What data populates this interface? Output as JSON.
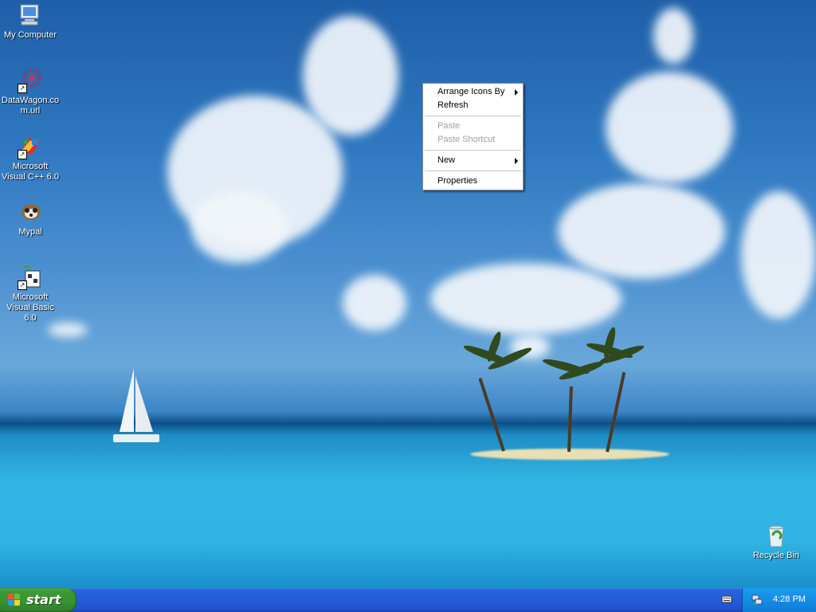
{
  "desktop": {
    "icons": [
      {
        "label": "My Computer",
        "icon": "my-computer-icon"
      },
      {
        "label": "DataWagon.co\nm.url",
        "icon": "datawagon-url-icon"
      },
      {
        "label": "Microsoft Visual C++ 6.0",
        "icon": "visual-cpp-icon"
      },
      {
        "label": "Mypal",
        "icon": "mypal-icon"
      },
      {
        "label": "Microsoft Visual Basic 6.0",
        "icon": "visual-basic-icon"
      }
    ],
    "recycle_bin": {
      "label": "Recycle Bin",
      "icon": "recycle-bin-icon"
    }
  },
  "context_menu": {
    "items": [
      {
        "label": "Arrange Icons By",
        "enabled": true,
        "submenu": true
      },
      {
        "label": "Refresh",
        "enabled": true,
        "submenu": false
      },
      {
        "label": "Paste",
        "enabled": false,
        "submenu": false
      },
      {
        "label": "Paste Shortcut",
        "enabled": false,
        "submenu": false
      },
      {
        "label": "New",
        "enabled": true,
        "submenu": true
      },
      {
        "label": "Properties",
        "enabled": true,
        "submenu": false
      }
    ]
  },
  "taskbar": {
    "start_label": "start",
    "tray": {
      "clock": "4:28 PM",
      "icons": [
        "keyboard-icon",
        "network-icon"
      ]
    }
  },
  "colors": {
    "taskbar_blue": "#245edb",
    "start_green": "#379230",
    "tray_blue": "#1590e6"
  }
}
